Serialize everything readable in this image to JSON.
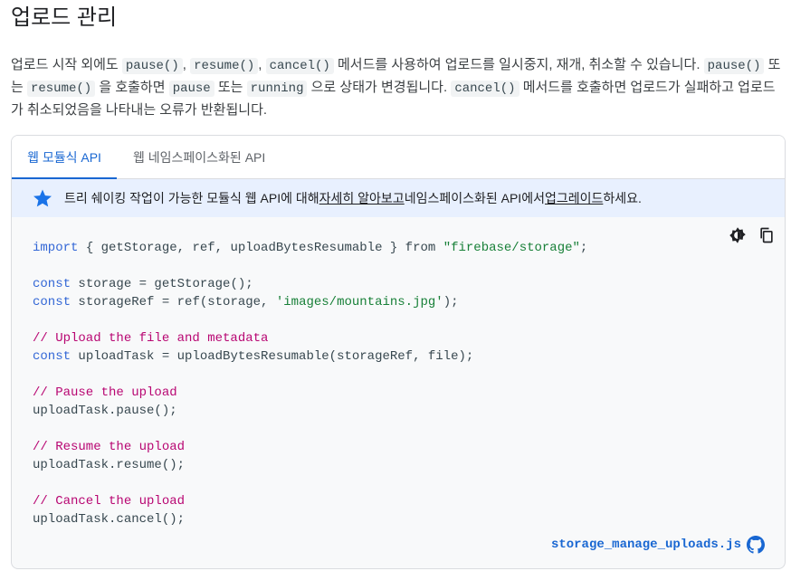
{
  "title": "업로드 관리",
  "paragraph": {
    "t1": "업로드 시작 외에도 ",
    "c1": "pause()",
    "t2": ", ",
    "c2": "resume()",
    "t3": ", ",
    "c3": "cancel()",
    "t4": " 메서드를 사용하여 업로드를 일시중지, 재개, 취소할 수 있습니다. ",
    "c4": "pause()",
    "t5": " 또는 ",
    "c5": "resume()",
    "t6": " 을 호출하면 ",
    "c6": "pause",
    "t7": " 또는 ",
    "c7": "running",
    "t8": " 으로 상태가 변경됩니다. ",
    "c8": "cancel()",
    "t9": " 메서드를 호출하면 업로드가 실패하고 업로드가 취소되었음을 나타내는 오류가 반환됩니다."
  },
  "tabs": {
    "modular": "웹 모듈식 API",
    "namespaced": "웹 네임스페이스화된 API"
  },
  "notice": {
    "t1": "트리 쉐이킹 작업이 가능한 모듈식 웹 API에 대해 ",
    "link1": "자세히 알아보고",
    "t2": " 네임스페이스화된 API에서 ",
    "link2": "업그레이드",
    "t3": "하세요."
  },
  "code": {
    "l1_kw": "import",
    "l1_a": " { getStorage, ref, uploadBytesResumable } from ",
    "l1_str": "\"firebase/storage\"",
    "l1_b": ";",
    "l2_kw": "const",
    "l2_a": " storage = getStorage();",
    "l3_kw": "const",
    "l3_a": " storageRef = ref(storage, ",
    "l3_str": "'images/mountains.jpg'",
    "l3_b": ");",
    "c1": "// Upload the file and metadata",
    "l4_kw": "const",
    "l4_a": " uploadTask = uploadBytesResumable(storageRef, file);",
    "c2": "// Pause the upload",
    "l5": "uploadTask.pause();",
    "c3": "// Resume the upload",
    "l6": "uploadTask.resume();",
    "c4": "// Cancel the upload",
    "l7": "uploadTask.cancel();"
  },
  "source_file": "storage_manage_uploads.js",
  "icons": {
    "theme": "theme-toggle-icon",
    "copy": "copy-icon",
    "star": "star-icon",
    "github": "github-icon"
  },
  "colors": {
    "accent": "#1967d2",
    "notice_bg": "#e8f0fe",
    "keyword": "#3367d6",
    "string": "#188038",
    "comment": "#b80672"
  }
}
